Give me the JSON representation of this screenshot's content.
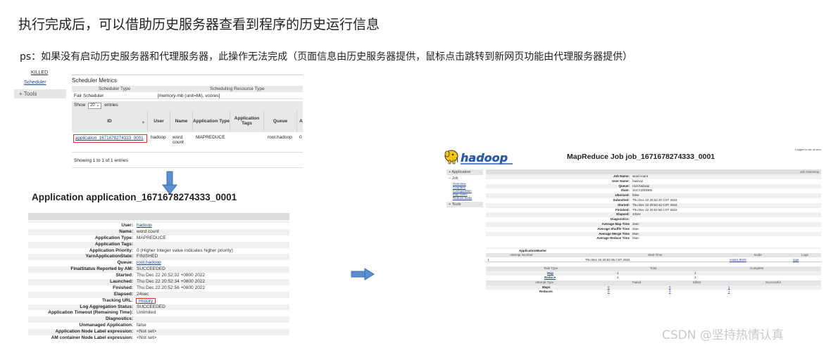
{
  "headline": "执行完成后，可以借助历史服务器查看到程序的历史运行信息",
  "subline": "ps：如果没有启动历史服务器和代理服务器，此操作无法完成（页面信息由历史服务器提供，鼠标点击跳转到新网页功能由代理服务器提供）",
  "watermark": "CSDN @坚持热情认真",
  "scheduler_screen": {
    "nav": {
      "killed": "KILLED",
      "scheduler": "Scheduler",
      "tools": "Tools"
    },
    "metrics_title": "Scheduler Metrics",
    "metrics_headers": [
      "Scheduler Type",
      "Scheduling Resource Type"
    ],
    "metrics_values": [
      "Fair Scheduler",
      "[memory-mb (unit=Mi), vcores]"
    ],
    "show_prefix": "Show",
    "show_count": "20",
    "show_suffix": "entries",
    "columns": [
      "ID",
      "User",
      "Name",
      "Application Type",
      "Application Tags",
      "Queue",
      "A"
    ],
    "row": {
      "id": "application_1671678274333_0001",
      "user": "hadoop",
      "name": "word count",
      "type": "MAPREDUCE",
      "tags": "",
      "queue": "root.hadoop",
      "extra": "0"
    },
    "showing": "Showing 1 to 1 of 1 entries"
  },
  "application_screen": {
    "title": "Application application_1671678274333_0001",
    "fields": [
      {
        "k": "User:",
        "v": "hadoop",
        "style": "link"
      },
      {
        "k": "Name:",
        "v": "word count",
        "style": ""
      },
      {
        "k": "Application Type:",
        "v": "MAPREDUCE",
        "style": ""
      },
      {
        "k": "Application Tags:",
        "v": "",
        "style": ""
      },
      {
        "k": "Application Priority:",
        "v": "0 (Higher Integer value indicates higher priority)",
        "style": ""
      },
      {
        "k": "YarnApplicationState:",
        "v": "FINISHED",
        "style": ""
      },
      {
        "k": "Queue:",
        "v": "root.hadoop",
        "style": "link"
      },
      {
        "k": "FinalStatus Reported by AM:",
        "v": "SUCCEEDED",
        "style": ""
      },
      {
        "k": "Started:",
        "v": "Thu Dec 22 20:52:32 +0800 2022",
        "style": ""
      },
      {
        "k": "Launched:",
        "v": "Thu Dec 22 20:52:34 +0800 2022",
        "style": ""
      },
      {
        "k": "Finished:",
        "v": "Thu Dec 22 20:52:56 +0800 2022",
        "style": ""
      },
      {
        "k": "Elapsed:",
        "v": "24sec",
        "style": ""
      },
      {
        "k": "Tracking URL:",
        "v": "History",
        "style": "boxed link"
      },
      {
        "k": "Log Aggregation Status:",
        "v": "SUCCEEDED",
        "style": ""
      },
      {
        "k": "Application Timeout (Remaining Time):",
        "v": "Unlimited",
        "style": ""
      },
      {
        "k": "Diagnostics:",
        "v": "",
        "style": ""
      },
      {
        "k": "Unmanaged Application:",
        "v": "false",
        "style": ""
      },
      {
        "k": "Application Node Label expression:",
        "v": "<Not set>",
        "style": ""
      },
      {
        "k": "AM container Node Label expression:",
        "v": "<Not set>",
        "style": ""
      }
    ]
  },
  "job_screen": {
    "logo_text": "hadoop",
    "title": "MapReduce Job job_1671678274333_0001",
    "logged_in": "Logged in as: dr.who",
    "nav": {
      "application": "Application",
      "job": "Job",
      "job_items": [
        "Overview",
        "Counters",
        "Configuration",
        "Map tasks",
        "Reduce tasks"
      ],
      "tools": "Tools"
    },
    "overview_header": "Job Overview",
    "fields": [
      {
        "k": "Job Name:",
        "v": "word count"
      },
      {
        "k": "User Name:",
        "v": "hadoop"
      },
      {
        "k": "Queue:",
        "v": "root.hadoop"
      },
      {
        "k": "State:",
        "v": "SUCCEEDED"
      },
      {
        "k": "Uberized:",
        "v": "false"
      },
      {
        "k": "Submitted:",
        "v": "Thu Dec 22 20:52:32 CST 2022"
      },
      {
        "k": "Started:",
        "v": "Thu Dec 22 20:52:42 CST 2022"
      },
      {
        "k": "Finished:",
        "v": "Thu Dec 22 20:52:56 CST 2022"
      },
      {
        "k": "Elapsed:",
        "v": "13sec"
      },
      {
        "k": "Diagnostics:",
        "v": ""
      },
      {
        "k": "Average Map Time",
        "v": "3sec"
      },
      {
        "k": "Average Shuffle Time",
        "v": "3sec"
      },
      {
        "k": "Average Merge Time",
        "v": "0sec"
      },
      {
        "k": "Average Reduce Time",
        "v": "0sec"
      }
    ],
    "am": {
      "title": "ApplicationMaster",
      "headers": [
        "Attempt Number",
        "Start Time",
        "Node",
        "Logs"
      ],
      "row": [
        "1",
        "Thu Dec 22 20:52:36 CST 2022",
        "node1:8042",
        "logs"
      ]
    },
    "tasks": {
      "headers": [
        "Task Type",
        "Total",
        "Complete"
      ],
      "rows": [
        {
          "type": "Map",
          "total": "1",
          "complete": "1"
        },
        {
          "type": "Reduce",
          "total": "1",
          "complete": "1"
        }
      ],
      "attempt_headers": [
        "Attempt Type",
        "Failed",
        "Killed",
        "Successful"
      ],
      "attempt_rows": [
        {
          "type": "Maps",
          "failed": "0",
          "killed": "0",
          "successful": "1"
        },
        {
          "type": "Reduces",
          "failed": "0",
          "killed": "0",
          "successful": "1"
        }
      ]
    }
  }
}
